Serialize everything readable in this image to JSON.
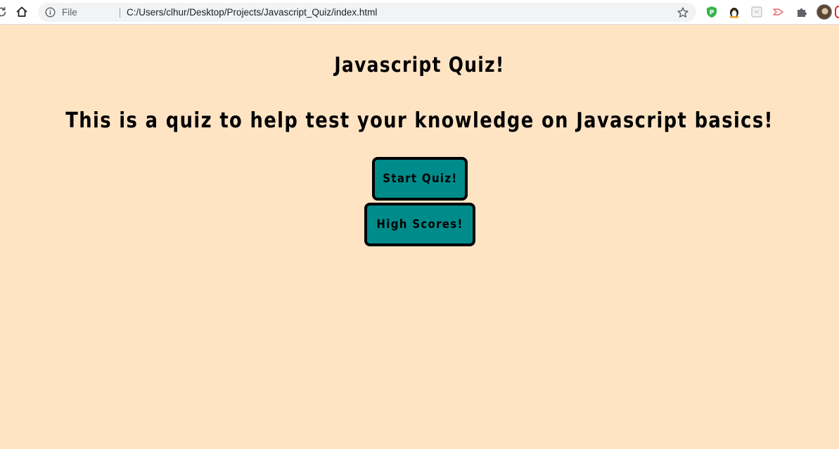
{
  "browser": {
    "scheme_label": "File",
    "url": "C:/Users/clhur/Desktop/Projects/Javascript_Quiz/index.html",
    "icons": [
      "reload-icon",
      "home-icon",
      "info-icon",
      "star-icon",
      "vpn-extension-icon",
      "penguin-extension-icon",
      "box-extension-icon",
      "arrow-extension-icon",
      "puzzle-extension-icon",
      "profile-avatar"
    ]
  },
  "page": {
    "background": "#ffe4c4",
    "title": "Javascript Quiz!",
    "subtitle": "This is a quiz to help test your knowledge on Javascript basics!",
    "start_label": "Start Quiz!",
    "scores_label": "High Scores!",
    "button_color": "#008b8b"
  }
}
